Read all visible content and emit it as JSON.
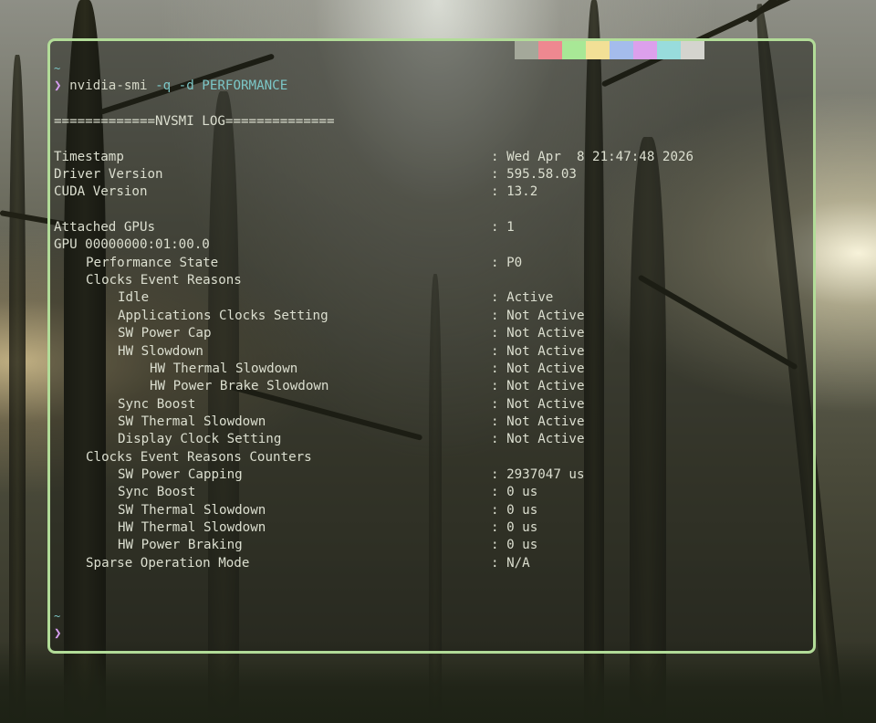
{
  "swatch_colors": [
    "#a4a89a",
    "#ee8890",
    "#a8e896",
    "#f2e096",
    "#a4bcec",
    "#dca0ec",
    "#98dcdc",
    "#d4d4ce"
  ],
  "terminal": {
    "prompt_tilde": "~",
    "prompt_char": "❯",
    "command": {
      "program": "nvidia-smi",
      "args": "-q -d PERFORMANCE"
    },
    "log_header": "=============NVSMI LOG==============",
    "rows": {
      "timestamp": {
        "label": "Timestamp",
        "value": ": Wed Apr  8 21:47:48 2026"
      },
      "driver_version": {
        "label": "Driver Version",
        "value": ": 595.58.03"
      },
      "cuda_version": {
        "label": "CUDA Version",
        "value": ": 13.2"
      },
      "attached_gpus": {
        "label": "Attached GPUs",
        "value": ": 1"
      },
      "gpu_id": {
        "label": "GPU 00000000:01:00.0"
      },
      "performance_state": {
        "label": "Performance State",
        "value": ": P0"
      },
      "clocks_event_reasons": {
        "label": "Clocks Event Reasons"
      },
      "idle": {
        "label": "Idle",
        "value": ": Active"
      },
      "app_clocks_setting": {
        "label": "Applications Clocks Setting",
        "value": ": Not Active"
      },
      "sw_power_cap": {
        "label": "SW Power Cap",
        "value": ": Not Active"
      },
      "hw_slowdown": {
        "label": "HW Slowdown",
        "value": ": Not Active"
      },
      "hw_thermal_slowdown": {
        "label": "HW Thermal Slowdown",
        "value": ": Not Active"
      },
      "hw_power_brake_slowdown": {
        "label": "HW Power Brake Slowdown",
        "value": ": Not Active"
      },
      "sync_boost": {
        "label": "Sync Boost",
        "value": ": Not Active"
      },
      "sw_thermal_slowdown": {
        "label": "SW Thermal Slowdown",
        "value": ": Not Active"
      },
      "display_clock_setting": {
        "label": "Display Clock Setting",
        "value": ": Not Active"
      },
      "clocks_event_reasons_counters": {
        "label": "Clocks Event Reasons Counters"
      },
      "sw_power_capping": {
        "label": "SW Power Capping",
        "value": ": 2937047 us"
      },
      "sync_boost_counter": {
        "label": "Sync Boost",
        "value": ": 0 us"
      },
      "sw_thermal_slowdown_counter": {
        "label": "SW Thermal Slowdown",
        "value": ": 0 us"
      },
      "hw_thermal_slowdown_counter": {
        "label": "HW Thermal Slowdown",
        "value": ": 0 us"
      },
      "hw_power_braking_counter": {
        "label": "HW Power Braking",
        "value": ": 0 us"
      },
      "sparse_operation_mode": {
        "label": "Sparse Operation Mode",
        "value": ": N/A"
      }
    }
  }
}
